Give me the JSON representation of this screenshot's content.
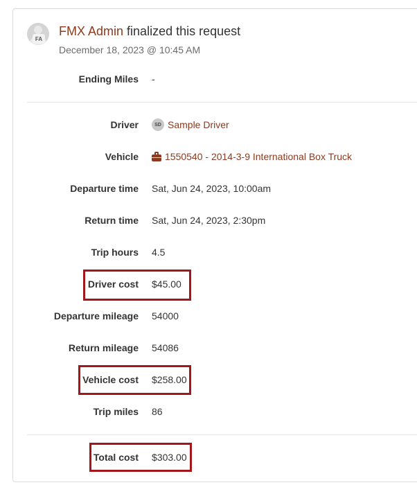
{
  "event": {
    "actor": "FMX Admin",
    "action": "finalized this request",
    "timestamp": "December 18, 2023 @ 10:45 AM",
    "avatar_initials": "FA"
  },
  "fields": {
    "ending_miles": {
      "label": "Ending Miles",
      "value": "-"
    },
    "driver": {
      "label": "Driver",
      "badge": "SD",
      "value": "Sample Driver"
    },
    "vehicle": {
      "label": "Vehicle",
      "icon": "briefcase-icon",
      "value": "1550540 - 2014-3-9 International Box Truck"
    },
    "departure_time": {
      "label": "Departure time",
      "value": "Sat, Jun 24, 2023, 10:00am"
    },
    "return_time": {
      "label": "Return time",
      "value": "Sat, Jun 24, 2023, 2:30pm"
    },
    "trip_hours": {
      "label": "Trip hours",
      "value": "4.5"
    },
    "driver_cost": {
      "label": "Driver cost",
      "value": "$45.00"
    },
    "departure_mileage": {
      "label": "Departure mileage",
      "value": "54000"
    },
    "return_mileage": {
      "label": "Return mileage",
      "value": "54086"
    },
    "vehicle_cost": {
      "label": "Vehicle cost",
      "value": "$258.00"
    },
    "trip_miles": {
      "label": "Trip miles",
      "value": "86"
    },
    "total_cost": {
      "label": "Total cost",
      "value": "$303.00"
    }
  },
  "colors": {
    "link": "#8b3a1f",
    "highlight": "#a3161c",
    "border": "#dcdcdc"
  }
}
